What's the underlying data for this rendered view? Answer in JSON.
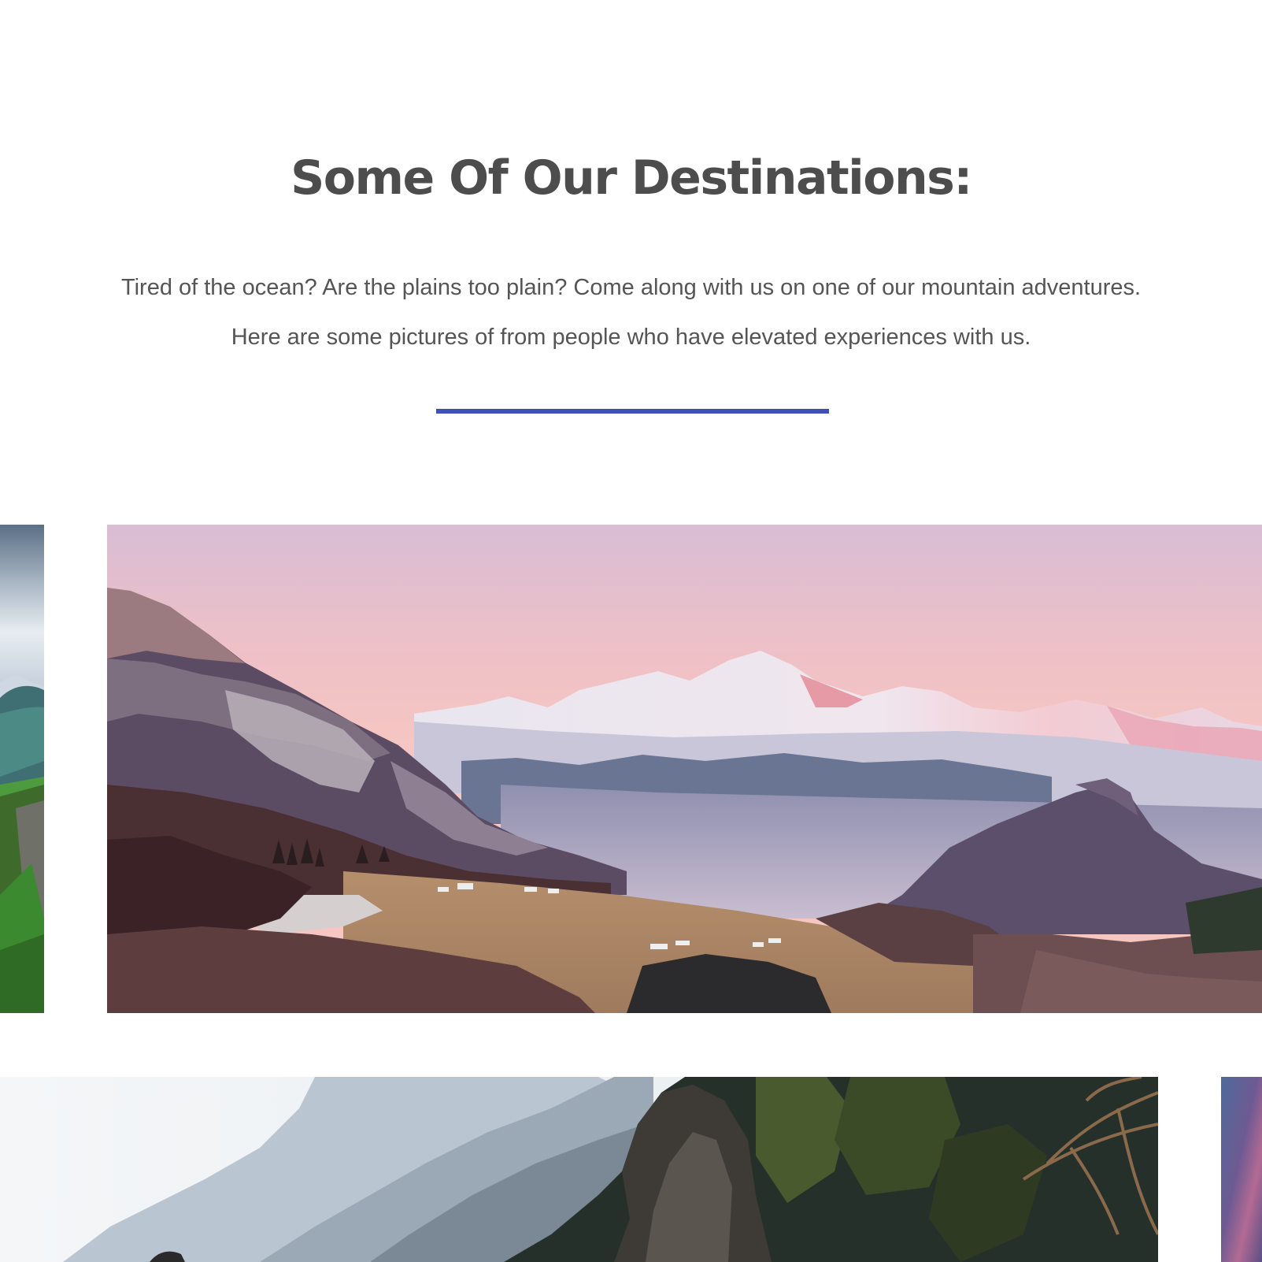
{
  "destinations": {
    "title": "Some Of Our Destinations:",
    "description_line1": "Tired of the ocean? Are the plains too plain? Come along with us on one of our mountain adventures.",
    "description_line2": "Here are some pictures of from people who have elevated experiences with us.",
    "accent_color": "#3f51b5",
    "text_color": "#4d4d4d"
  },
  "gallery": {
    "photos": [
      {
        "name": "green-mountain-ridge-photo",
        "visibility": "partial"
      },
      {
        "name": "snowy-mountain-range-sunset-photo",
        "visibility": "full"
      },
      {
        "name": "rocky-cliff-forest-photo",
        "visibility": "partial"
      },
      {
        "name": "purple-sky-photo",
        "visibility": "partial"
      }
    ]
  }
}
